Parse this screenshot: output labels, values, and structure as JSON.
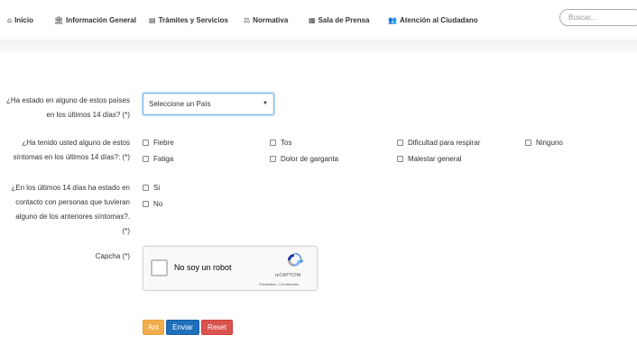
{
  "nav": {
    "inicio": "Inicio",
    "informacion": "Información General",
    "tramites": "Trámites y Servicios",
    "normativa": "Normativa",
    "prensa": "Sala de Prensa",
    "atencion": "Atención al Ciudadano",
    "search_placeholder": "Buscar..."
  },
  "form": {
    "q1_label_line1": "¿Ha estado en alguno de estos países",
    "q1_label_line2": "en los últimos 14 días? (*)",
    "country_select": "Seleccione un País",
    "q2_label_line1": "¿Ha tenido usted alguno de estos",
    "q2_label_line2": "síntomas en los últimos 14 días?: (*)",
    "symptoms": [
      "Fiebre",
      "Tos",
      "Dificultad para respirar",
      "Ninguno",
      "Fatiga",
      "Dolor de garganta",
      "Malestar general"
    ],
    "q3_label_line1": "¿En los últimos 14 días ha estado en",
    "q3_label_line2": "contacto con personas que tuvieran",
    "q3_label_line3": "alguno de los anteriores síntomas?.",
    "q3_label_line4": "(*)",
    "yes": "Si",
    "no": "No",
    "captcha_label": "Capcha (*)"
  },
  "captcha": {
    "text": "No soy un robot",
    "brand": "reCAPTCHA",
    "terms": "Privacidad - Condiciones"
  },
  "buttons": {
    "ant": "Ant",
    "enviar": "Enviar",
    "reset": "Reset"
  },
  "colors": {
    "ant": "#f0ad4e",
    "enviar": "#1f6fbb",
    "reset": "#d9534f",
    "focus_border": "#66afe9"
  }
}
